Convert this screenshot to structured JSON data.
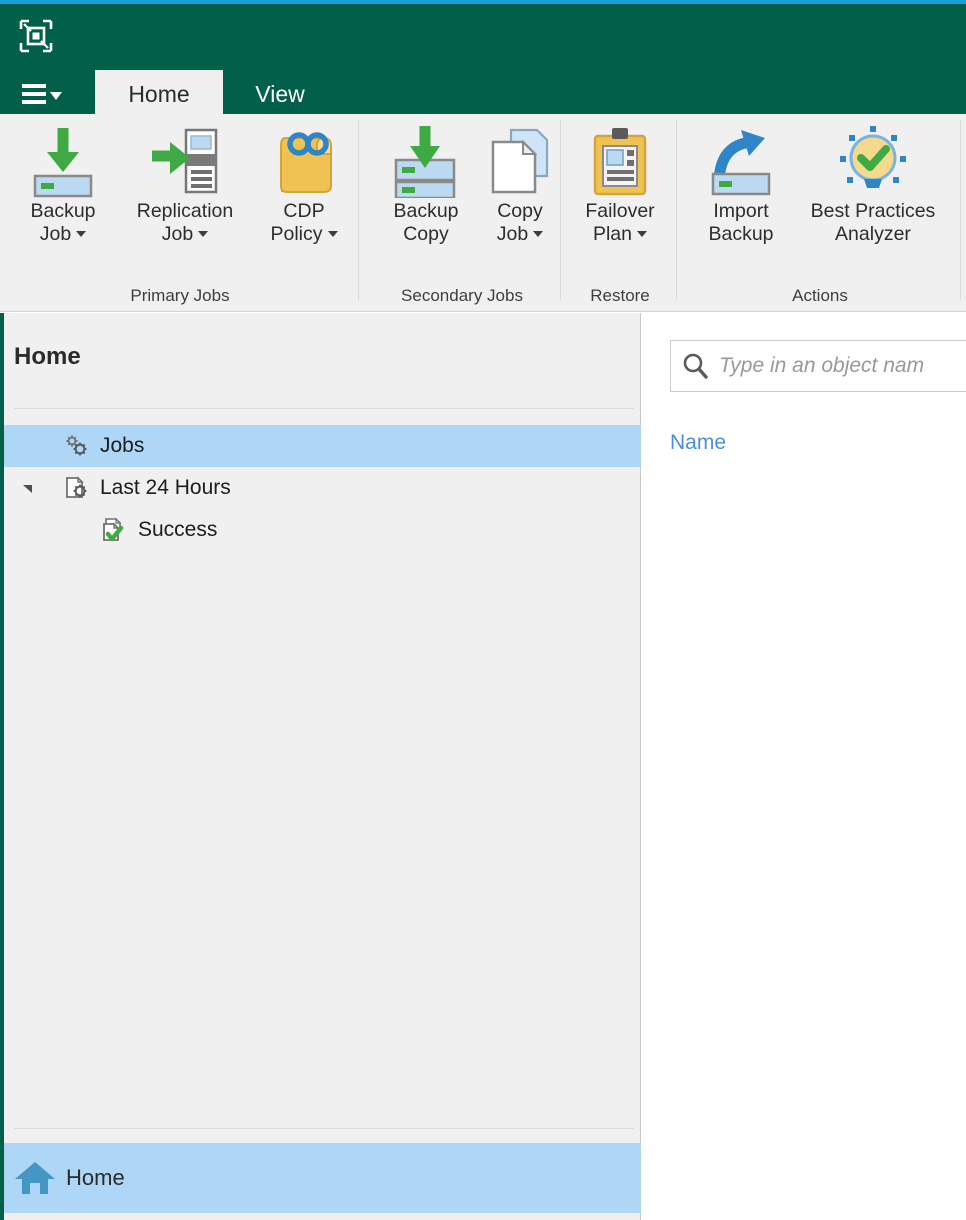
{
  "app": {
    "logo_icon": "veeam-logo-icon",
    "accent_green": "#015f4a",
    "accent_blue_top": "#1b9dd9",
    "selection_blue": "#aed6f7",
    "link_blue": "#4a90d9"
  },
  "titlebar": {
    "menu_icon": "hamburger-menu-icon",
    "tabs": [
      {
        "label": "Home",
        "active": true
      },
      {
        "label": "View",
        "active": false
      }
    ]
  },
  "ribbon": {
    "groups": [
      {
        "label": "Primary Jobs",
        "buttons": [
          {
            "label": "Backup\nJob",
            "icon": "backup-job-icon",
            "has_dropdown": true
          },
          {
            "label": "Replication\nJob",
            "icon": "replication-job-icon",
            "has_dropdown": true
          },
          {
            "label": "CDP\nPolicy",
            "icon": "cdp-policy-icon",
            "has_dropdown": true
          }
        ]
      },
      {
        "label": "Secondary Jobs",
        "buttons": [
          {
            "label": "Backup\nCopy",
            "icon": "backup-copy-icon",
            "has_dropdown": false
          },
          {
            "label": "Copy\nJob",
            "icon": "copy-job-icon",
            "has_dropdown": true
          }
        ]
      },
      {
        "label": "Restore",
        "buttons": [
          {
            "label": "Failover\nPlan",
            "icon": "failover-plan-icon",
            "has_dropdown": true
          }
        ]
      },
      {
        "label": "Actions",
        "buttons": [
          {
            "label": "Import\nBackup",
            "icon": "import-backup-icon",
            "has_dropdown": false
          },
          {
            "label": "Best Practices\nAnalyzer",
            "icon": "best-practices-analyzer-icon",
            "has_dropdown": false
          }
        ]
      }
    ]
  },
  "sidebar": {
    "title": "Home",
    "tree": [
      {
        "label": "Jobs",
        "icon": "jobs-gear-icon",
        "selected": true,
        "indent": 0,
        "expander": "none"
      },
      {
        "label": "Last 24 Hours",
        "icon": "last-24-hours-icon",
        "selected": false,
        "indent": 0,
        "expander": "expanded"
      },
      {
        "label": "Success",
        "icon": "success-icon",
        "selected": false,
        "indent": 1,
        "expander": "none"
      }
    ],
    "footer": {
      "label": "Home",
      "icon": "home-icon",
      "selected": true
    }
  },
  "main": {
    "search": {
      "placeholder": "Type in an object nam",
      "value": "",
      "icon": "search-icon"
    },
    "columns": [
      {
        "label": "Name"
      }
    ],
    "rows": []
  }
}
